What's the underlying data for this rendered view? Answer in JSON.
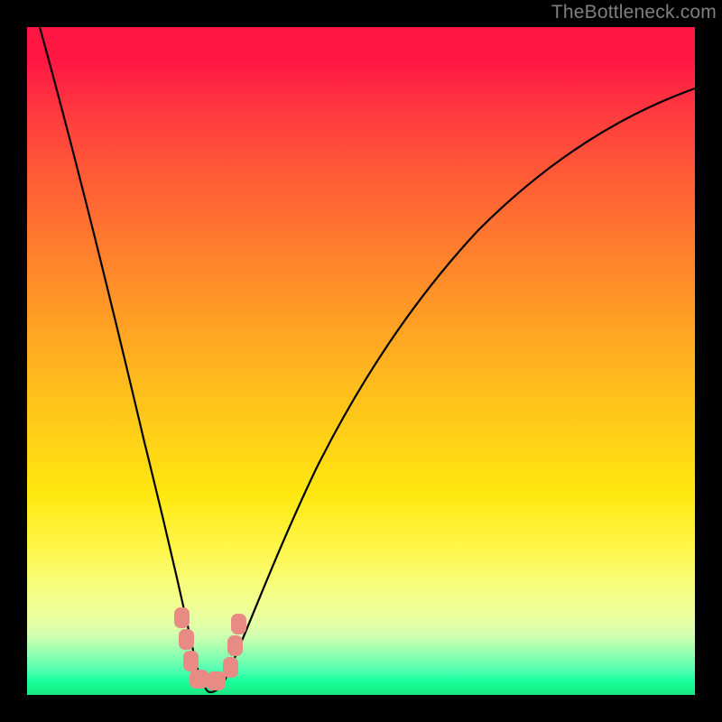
{
  "watermark": "TheBottleneck.com",
  "colors": {
    "frame": "#000000",
    "curve": "#000000",
    "marker_fill": "#e78b84",
    "gradient_top": "#ff1744",
    "gradient_bottom": "#18e680"
  },
  "chart_data": {
    "type": "line",
    "title": "",
    "xlabel": "",
    "ylabel": "",
    "xlim": [
      0,
      100
    ],
    "ylim": [
      0,
      100
    ],
    "grid": false,
    "note": "x is a normalized hardware-balance axis (0–100). y is bottleneck % where 0 = no bottleneck (green) and 100 = full bottleneck (red). Curve falls sharply to a minimum near x≈27 then rises with diminishing slope. Values estimated from pixel positions; axes unlabeled.",
    "series": [
      {
        "name": "bottleneck-curve",
        "x": [
          2,
          5,
          8,
          11,
          14,
          17,
          20,
          23,
          25,
          27,
          29,
          32,
          36,
          40,
          45,
          50,
          56,
          62,
          70,
          78,
          86,
          94,
          100
        ],
        "values": [
          100,
          89,
          78,
          67,
          57,
          46,
          35,
          22,
          9,
          0,
          2,
          15,
          29,
          40,
          50,
          58,
          65,
          71,
          77,
          82,
          85,
          88,
          90
        ]
      }
    ],
    "markers": {
      "note": "Salmon rounded-rect markers near the curve minimum, forming an L-shape.",
      "points": [
        {
          "x": 23.2,
          "y": 12
        },
        {
          "x": 23.8,
          "y": 7
        },
        {
          "x": 24.4,
          "y": 3
        },
        {
          "x": 25.5,
          "y": 1
        },
        {
          "x": 27.5,
          "y": 1
        },
        {
          "x": 29.5,
          "y": 1
        },
        {
          "x": 30.3,
          "y": 4
        },
        {
          "x": 30.9,
          "y": 9
        }
      ]
    }
  }
}
